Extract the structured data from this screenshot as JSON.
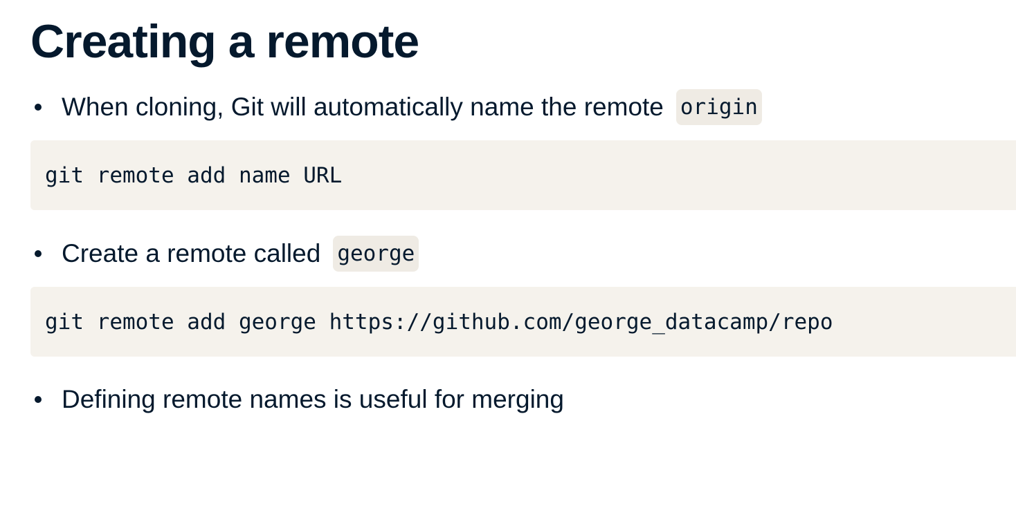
{
  "slide": {
    "title": "Creating a remote"
  },
  "bullets": [
    {
      "text": "When cloning, Git will automatically name the remote",
      "code": "origin"
    },
    {
      "text": "Create a remote called",
      "code": "george"
    },
    {
      "text": "Defining remote names is useful for merging"
    }
  ],
  "code_blocks": [
    {
      "code": "git remote add name URL"
    },
    {
      "code": "git remote add george https://github.com/george_datacamp/repo"
    }
  ],
  "colors": {
    "text": "#05192d",
    "inline_code_bg": "#efebe4",
    "code_block_bg": "#f5f2ec"
  }
}
